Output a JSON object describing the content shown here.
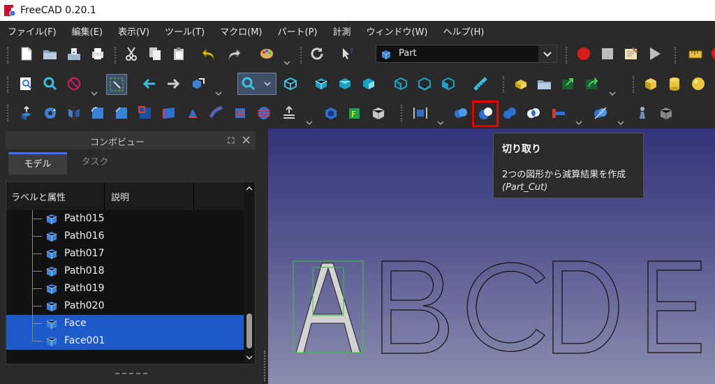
{
  "window": {
    "title": "FreeCAD 0.20.1"
  },
  "menu": [
    "ファイル(F)",
    "編集(E)",
    "表示(V)",
    "ツール(T)",
    "マクロ(M)",
    "パート(P)",
    "計測",
    "ウィンドウ(W)",
    "ヘルプ(H)"
  ],
  "workbench": {
    "selected": "Part"
  },
  "combo": {
    "title": "コンボビュー",
    "tabs": {
      "model": "モデル",
      "task": "タスク"
    },
    "columns": {
      "label": "ラベルと属性",
      "description": "説明"
    },
    "items": [
      {
        "label": "Path015",
        "selected": false
      },
      {
        "label": "Path016",
        "selected": false
      },
      {
        "label": "Path017",
        "selected": false
      },
      {
        "label": "Path018",
        "selected": false
      },
      {
        "label": "Path019",
        "selected": false
      },
      {
        "label": "Path020",
        "selected": false
      },
      {
        "label": "Face",
        "selected": true
      },
      {
        "label": "Face001",
        "selected": true
      }
    ]
  },
  "viewport": {
    "text": "ABCDE"
  },
  "tooltip": {
    "title": "切り取り",
    "description": "2つの図形から減算結果を作成",
    "command": "(Part_Cut)"
  },
  "colors": {
    "accent": "#3a78d6",
    "selection": "#1d5ac8",
    "highlight": "#e00000",
    "bounding_box": "#33cc33",
    "face_fill": "#d2d2d2"
  }
}
